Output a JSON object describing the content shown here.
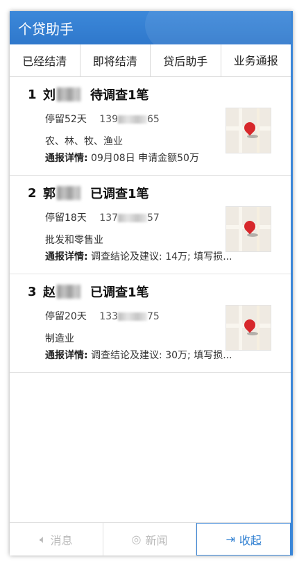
{
  "app": {
    "title": "个贷助手"
  },
  "tabs": [
    {
      "label": "已经结清"
    },
    {
      "label": "即将结清"
    },
    {
      "label": "贷后助手"
    },
    {
      "label": "业务通报"
    }
  ],
  "items": [
    {
      "index": "1",
      "surname": "刘",
      "status": "待调查1笔",
      "stay": "停留52天",
      "phone_prefix": "139",
      "phone_suffix": "65",
      "industry": "农、林、牧、渔业",
      "detail_label": "通报详情:",
      "detail_text": " 09月08日 申请金额50万"
    },
    {
      "index": "2",
      "surname": "郭",
      "status": "已调查1笔",
      "stay": "停留18天",
      "phone_prefix": "137",
      "phone_suffix": "57",
      "industry": "批发和零售业",
      "detail_label": "通报详情:",
      "detail_text": " 调查结论及建议: 14万; 填写损..."
    },
    {
      "index": "3",
      "surname": "赵",
      "status": "已调查1笔",
      "stay": "停留20天",
      "phone_prefix": "133",
      "phone_suffix": "75",
      "industry": "制造业",
      "detail_label": "通报详情:",
      "detail_text": " 调查结论及建议: 30万; 填写损..."
    }
  ],
  "footer": {
    "message_label": "消息",
    "news_label": "新闻",
    "collapse_label": "收起"
  },
  "colors": {
    "accent": "#2f78cc",
    "pin": "#d7282b"
  }
}
